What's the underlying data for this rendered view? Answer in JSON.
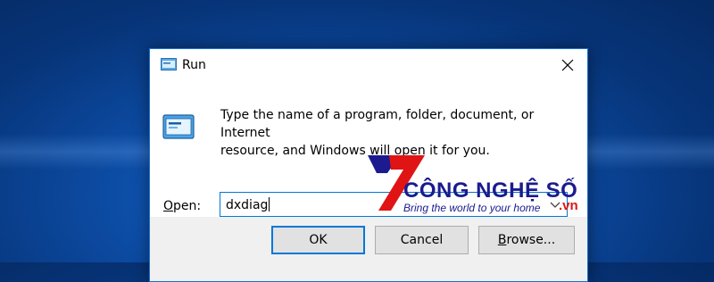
{
  "dialog": {
    "title": "Run",
    "description_line1": "Type the name of a program, folder, document, or Internet",
    "description_line2": "resource, and Windows will open it for you.",
    "open_label_accel": "O",
    "open_label_rest": "pen:",
    "open_value": "dxdiag",
    "buttons": {
      "ok": "OK",
      "cancel": "Cancel",
      "browse_accel": "B",
      "browse_rest": "rowse..."
    }
  },
  "watermark": {
    "brand": "CÔNG NGHỆ SỐ",
    "tagline": "Bring the world to your home",
    "tld": ".vn"
  },
  "colors": {
    "accent": "#0078d7",
    "footer_bg": "#f0f0f0",
    "button_bg": "#e1e1e1",
    "watermark_blue": "#1b1b8f",
    "watermark_red": "#e01414"
  },
  "icons": [
    "run-icon",
    "close-icon",
    "run-program-icon",
    "dropdown-arrow-icon",
    "watermark-logo-icon"
  ]
}
